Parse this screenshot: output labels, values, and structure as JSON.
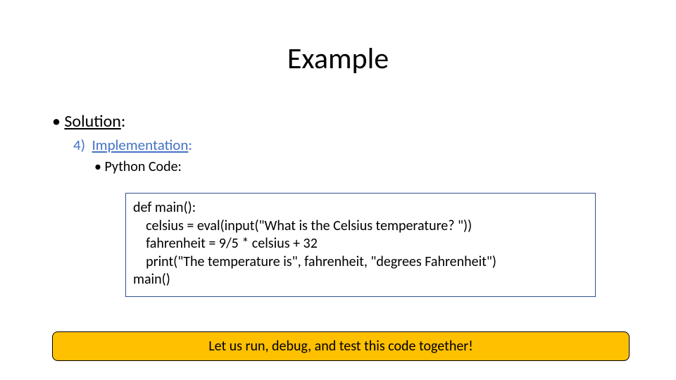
{
  "title": "Example",
  "solution_label": "Solution",
  "step": {
    "number": "4)",
    "label": "Implementation",
    "colon": ":"
  },
  "sub_label": "Python Code:",
  "code": {
    "l1": "def main():",
    "l2": "    celsius = eval(input(\"What is the Celsius temperature? \"))",
    "l3": "    fahrenheit = 9/5 * celsius + 32",
    "l4": "    print(\"The temperature is\", fahrenheit, \"degrees Fahrenheit\")",
    "l5": "",
    "l6": "main()"
  },
  "banner_text": "Let us run, debug, and test this code together!"
}
